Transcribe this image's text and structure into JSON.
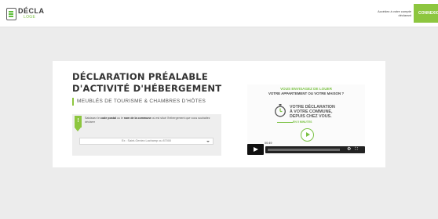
{
  "header": {
    "logo_text": "DÉCLA",
    "logo_sub": "LOGE",
    "account_link": "Accédez à votre compte déclarant",
    "connect_label": "CONNEXION"
  },
  "main": {
    "title_line1": "DÉCLARATION PRÉALABLE",
    "title_line2": "D'ACTIVITÉ D'HÉBERGEMENT",
    "subtitle": "MEUBLÉS DE TOURISME & CHAMBRES D'HÔTES",
    "search": {
      "flag": "!",
      "help_prefix": "Saisissez le ",
      "help_bold1": "code postal",
      "help_mid": " ou le ",
      "help_bold2": "nom de la commune",
      "help_suffix": " où est situé l'hébergement que vous souhaitez déclarer",
      "placeholder": "Ex : Saint-Geniez Lachamp ou 87000"
    }
  },
  "video": {
    "question_line1": "VOUS ENVISAGEZ DE LOUER",
    "question_line2": "VOTRE APPARTEMENT OU VOTRE MAISON ?",
    "message": "VOTRE DÉCLARATION À VOTRE COMMUNE, DEPUIS CHEZ VOUS.",
    "duration_badge": "EN 5 MINUTES",
    "time": "00:49",
    "settings_icon": "gear-icon",
    "fullscreen_icon": "fullscreen-icon"
  },
  "colors": {
    "accent": "#8dc63f",
    "background": "#ececec"
  }
}
